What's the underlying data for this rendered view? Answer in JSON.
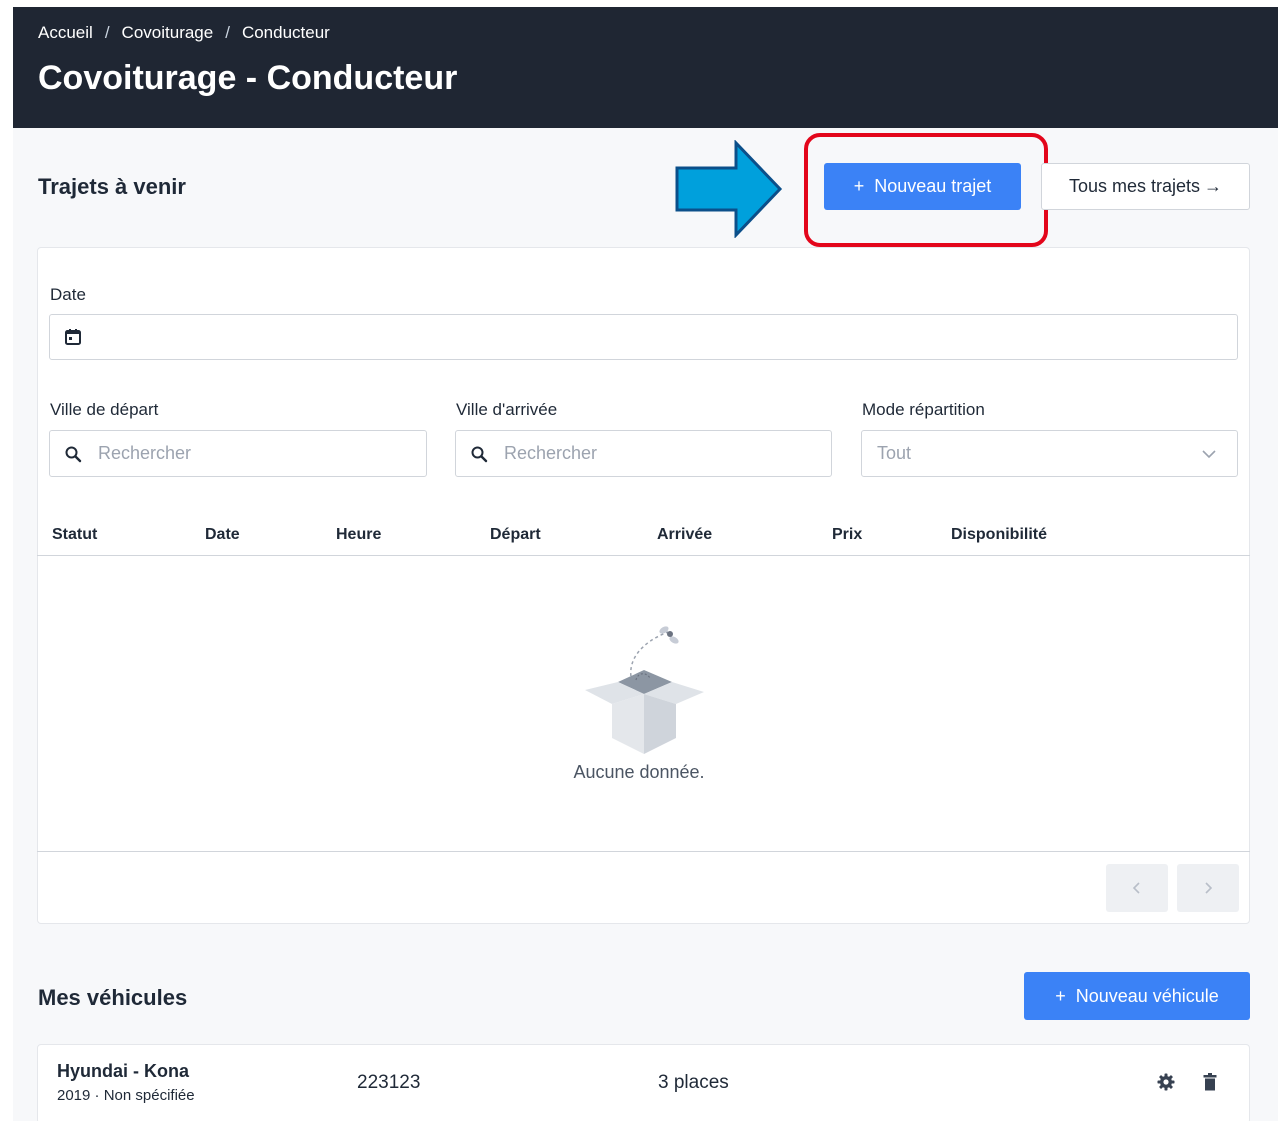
{
  "header": {
    "breadcrumb": [
      "Accueil",
      "Covoiturage",
      "Conducteur"
    ],
    "breadcrumb_separator": "/",
    "title": "Covoiturage - Conducteur"
  },
  "trips": {
    "section_title": "Trajets à venir",
    "new_trip_button": "Nouveau trajet",
    "new_trip_icon": "+",
    "all_trips_button": "Tous mes trajets",
    "all_trips_icon": "→"
  },
  "filters": {
    "date_label": "Date",
    "departure_label": "Ville de départ",
    "departure_placeholder": "Rechercher",
    "arrival_label": "Ville d'arrivée",
    "arrival_placeholder": "Rechercher",
    "mode_label": "Mode répartition",
    "mode_value": "Tout"
  },
  "table": {
    "columns": [
      "Statut",
      "Date",
      "Heure",
      "Départ",
      "Arrivée",
      "Prix",
      "Disponibilité"
    ],
    "empty_text": "Aucune donnée."
  },
  "vehicles": {
    "section_title": "Mes véhicules",
    "new_vehicle_button": "Nouveau véhicule",
    "new_vehicle_icon": "+",
    "items": [
      {
        "name": "Hyundai - Kona",
        "subtitle": "2019 · Non spécifiée",
        "plate": "223123",
        "seats": "3 places"
      }
    ]
  },
  "colors": {
    "header_bg": "#1f2633",
    "primary": "#3b82f6",
    "highlight": "#e3061b",
    "arrow": "#00a0dc"
  },
  "icons": [
    "calendar-icon",
    "search-icon",
    "chevron-down-icon",
    "chevron-left-icon",
    "chevron-right-icon",
    "gear-icon",
    "trash-icon",
    "plus-icon",
    "arrow-right-icon",
    "empty-box-icon"
  ]
}
